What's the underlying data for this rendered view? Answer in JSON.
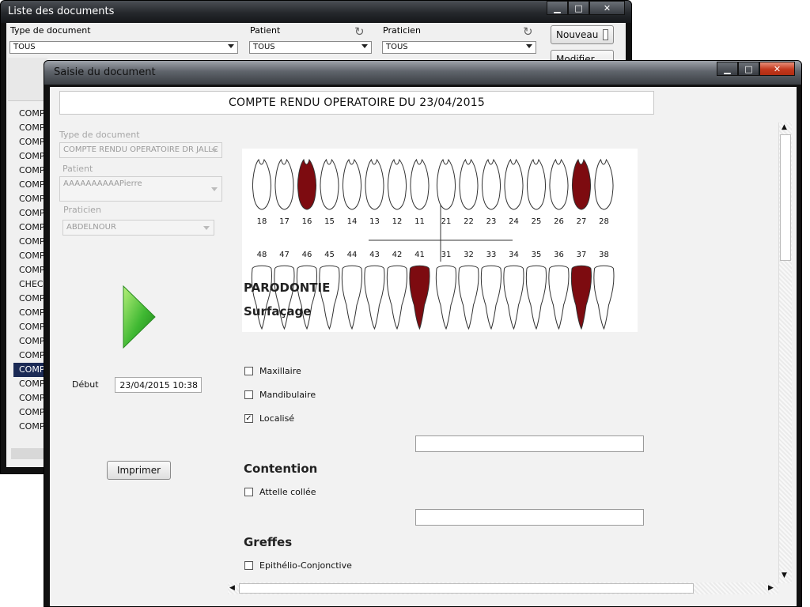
{
  "back_window": {
    "title": "Liste des documents",
    "controls": {
      "minimize": "▁",
      "maximize": "□",
      "close": "✕"
    },
    "filters": {
      "doc_type": {
        "label": "Type de document",
        "value": "TOUS"
      },
      "patient": {
        "label": "Patient",
        "value": "TOUS"
      },
      "practitioner": {
        "label": "Praticien",
        "value": "TOUS"
      }
    },
    "buttons": {
      "new": "Nouveau",
      "edit": "Modifier"
    },
    "list_items": [
      "COMPTE",
      "COMPTE",
      "COMPTE",
      "COMPTE",
      "COMPTE",
      "COMPTE",
      "COMPTE",
      "COMPTE",
      "COMPTE",
      "COMPTE",
      "COMPTE",
      "COMPTE",
      "CHECKL",
      "COMPTE",
      "COMPTE",
      "COMPTE",
      "COMPTE",
      "COMPTE",
      "COMPTE",
      "COMPTE",
      "COMPTE",
      "COMPTE",
      "COMPTE"
    ],
    "selected_index": 18
  },
  "front_window": {
    "title": "Saisie du document",
    "controls": {
      "minimize": "▁",
      "maximize": "□",
      "close": "✕"
    },
    "doc_title": "COMPTE RENDU OPERATOIRE DU 23/04/2015",
    "fields": {
      "doc_type": {
        "label": "Type de document",
        "value": "COMPTE RENDU OPERATOIRE DR JALLC"
      },
      "patient": {
        "label": "Patient",
        "value": "AAAAAAAAAAPierre"
      },
      "practitioner": {
        "label": "Praticien",
        "value": "ABDELNOUR"
      }
    },
    "debut": {
      "label": "Début",
      "value": "23/04/2015 10:38"
    },
    "print_label": "Imprimer",
    "dental_chart": {
      "upper": [
        "18",
        "17",
        "16",
        "15",
        "14",
        "13",
        "12",
        "11",
        "21",
        "22",
        "23",
        "24",
        "25",
        "26",
        "27",
        "28"
      ],
      "lower": [
        "48",
        "47",
        "46",
        "45",
        "44",
        "43",
        "42",
        "41",
        "31",
        "32",
        "33",
        "34",
        "35",
        "36",
        "37",
        "38"
      ],
      "highlighted": [
        "16",
        "27",
        "41",
        "37"
      ],
      "highlight_color": "#7d0b10"
    },
    "sections": {
      "main": "PARODONTIE",
      "surfacage": {
        "title": "Surfaçage",
        "options": [
          {
            "label": "Maxillaire",
            "checked": false
          },
          {
            "label": "Mandibulaire",
            "checked": false
          },
          {
            "label": "Localisé",
            "checked": true
          }
        ]
      },
      "contention": {
        "title": "Contention",
        "options": [
          {
            "label": "Attelle collée",
            "checked": false
          }
        ]
      },
      "greffes": {
        "title": "Greffes",
        "options": [
          {
            "label": "Epithélio-Conjonctive",
            "checked": false
          }
        ]
      }
    }
  }
}
